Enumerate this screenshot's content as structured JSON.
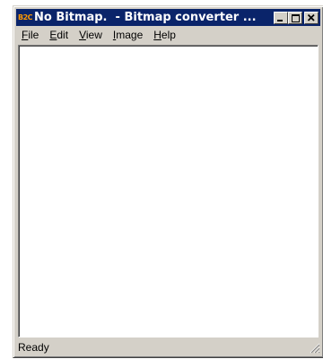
{
  "window": {
    "app_icon_text": "B2C",
    "title": "No Bitmap.  - Bitmap converter ...",
    "buttons": {
      "minimize": "minimize",
      "maximize": "maximize",
      "close": "close"
    }
  },
  "menu": {
    "items": [
      {
        "pre": "",
        "accel": "F",
        "post": "ile"
      },
      {
        "pre": "",
        "accel": "E",
        "post": "dit"
      },
      {
        "pre": "",
        "accel": "V",
        "post": "iew"
      },
      {
        "pre": "",
        "accel": "I",
        "post": "mage"
      },
      {
        "pre": "",
        "accel": "H",
        "post": "elp"
      }
    ]
  },
  "status": {
    "text": "Ready"
  },
  "colors": {
    "titlebar": "#0a246a",
    "face": "#d4d0c8",
    "client": "#ffffff"
  }
}
